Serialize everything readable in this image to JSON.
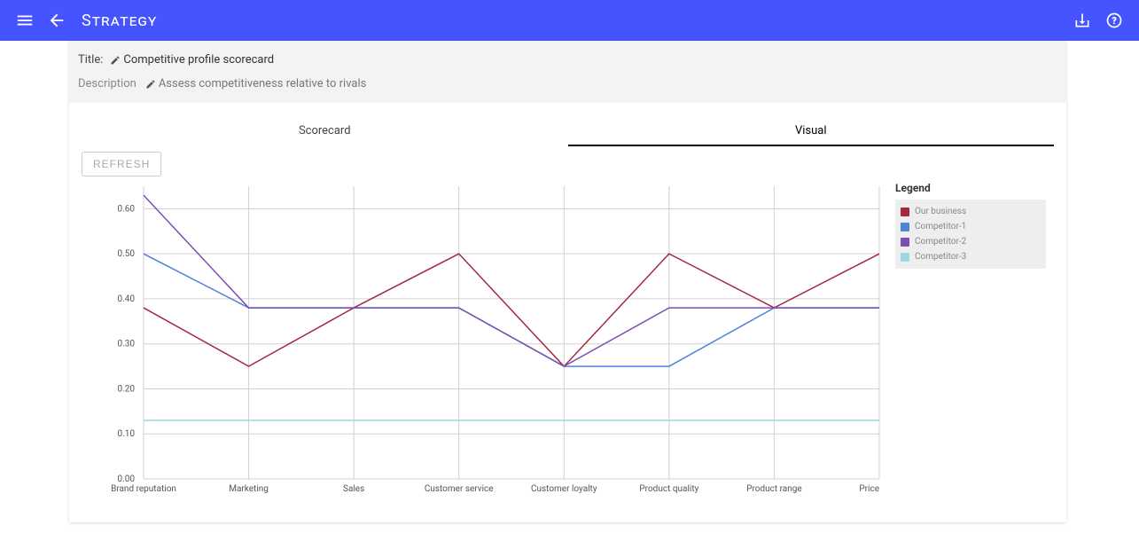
{
  "app_title": "Strategy",
  "title_label": "Title:",
  "title_value": "Competitive profile scorecard",
  "description_label": "Description",
  "description_value": "Assess competitiveness relative to rivals",
  "tabs": {
    "scorecard": "Scorecard",
    "visual": "Visual"
  },
  "refresh_label": "REFRESH",
  "legend_title": "Legend",
  "chart_data": {
    "type": "line",
    "categories": [
      "Brand reputation",
      "Marketing",
      "Sales",
      "Customer service",
      "Customer loyalty",
      "Product quality",
      "Product range",
      "Price"
    ],
    "series": [
      {
        "name": "Our business",
        "color": "#a52744",
        "values": [
          0.38,
          0.25,
          0.38,
          0.5,
          0.25,
          0.5,
          0.38,
          0.5
        ]
      },
      {
        "name": "Competitor-1",
        "color": "#4f81d8",
        "values": [
          0.5,
          0.38,
          0.38,
          0.38,
          0.25,
          0.25,
          0.38,
          0.38
        ]
      },
      {
        "name": "Competitor-2",
        "color": "#7a4fb0",
        "values": [
          0.63,
          0.38,
          0.38,
          0.38,
          0.25,
          0.38,
          0.38,
          0.38
        ]
      },
      {
        "name": "Competitor-3",
        "color": "#9bd6e4",
        "values": [
          0.13,
          0.13,
          0.13,
          0.13,
          0.13,
          0.13,
          0.13,
          0.13
        ]
      }
    ],
    "ylabel": "",
    "xlabel": "",
    "ylim": [
      0.0,
      0.65
    ],
    "yticks": [
      0.0,
      0.1,
      0.2,
      0.3,
      0.4,
      0.5,
      0.6
    ]
  }
}
